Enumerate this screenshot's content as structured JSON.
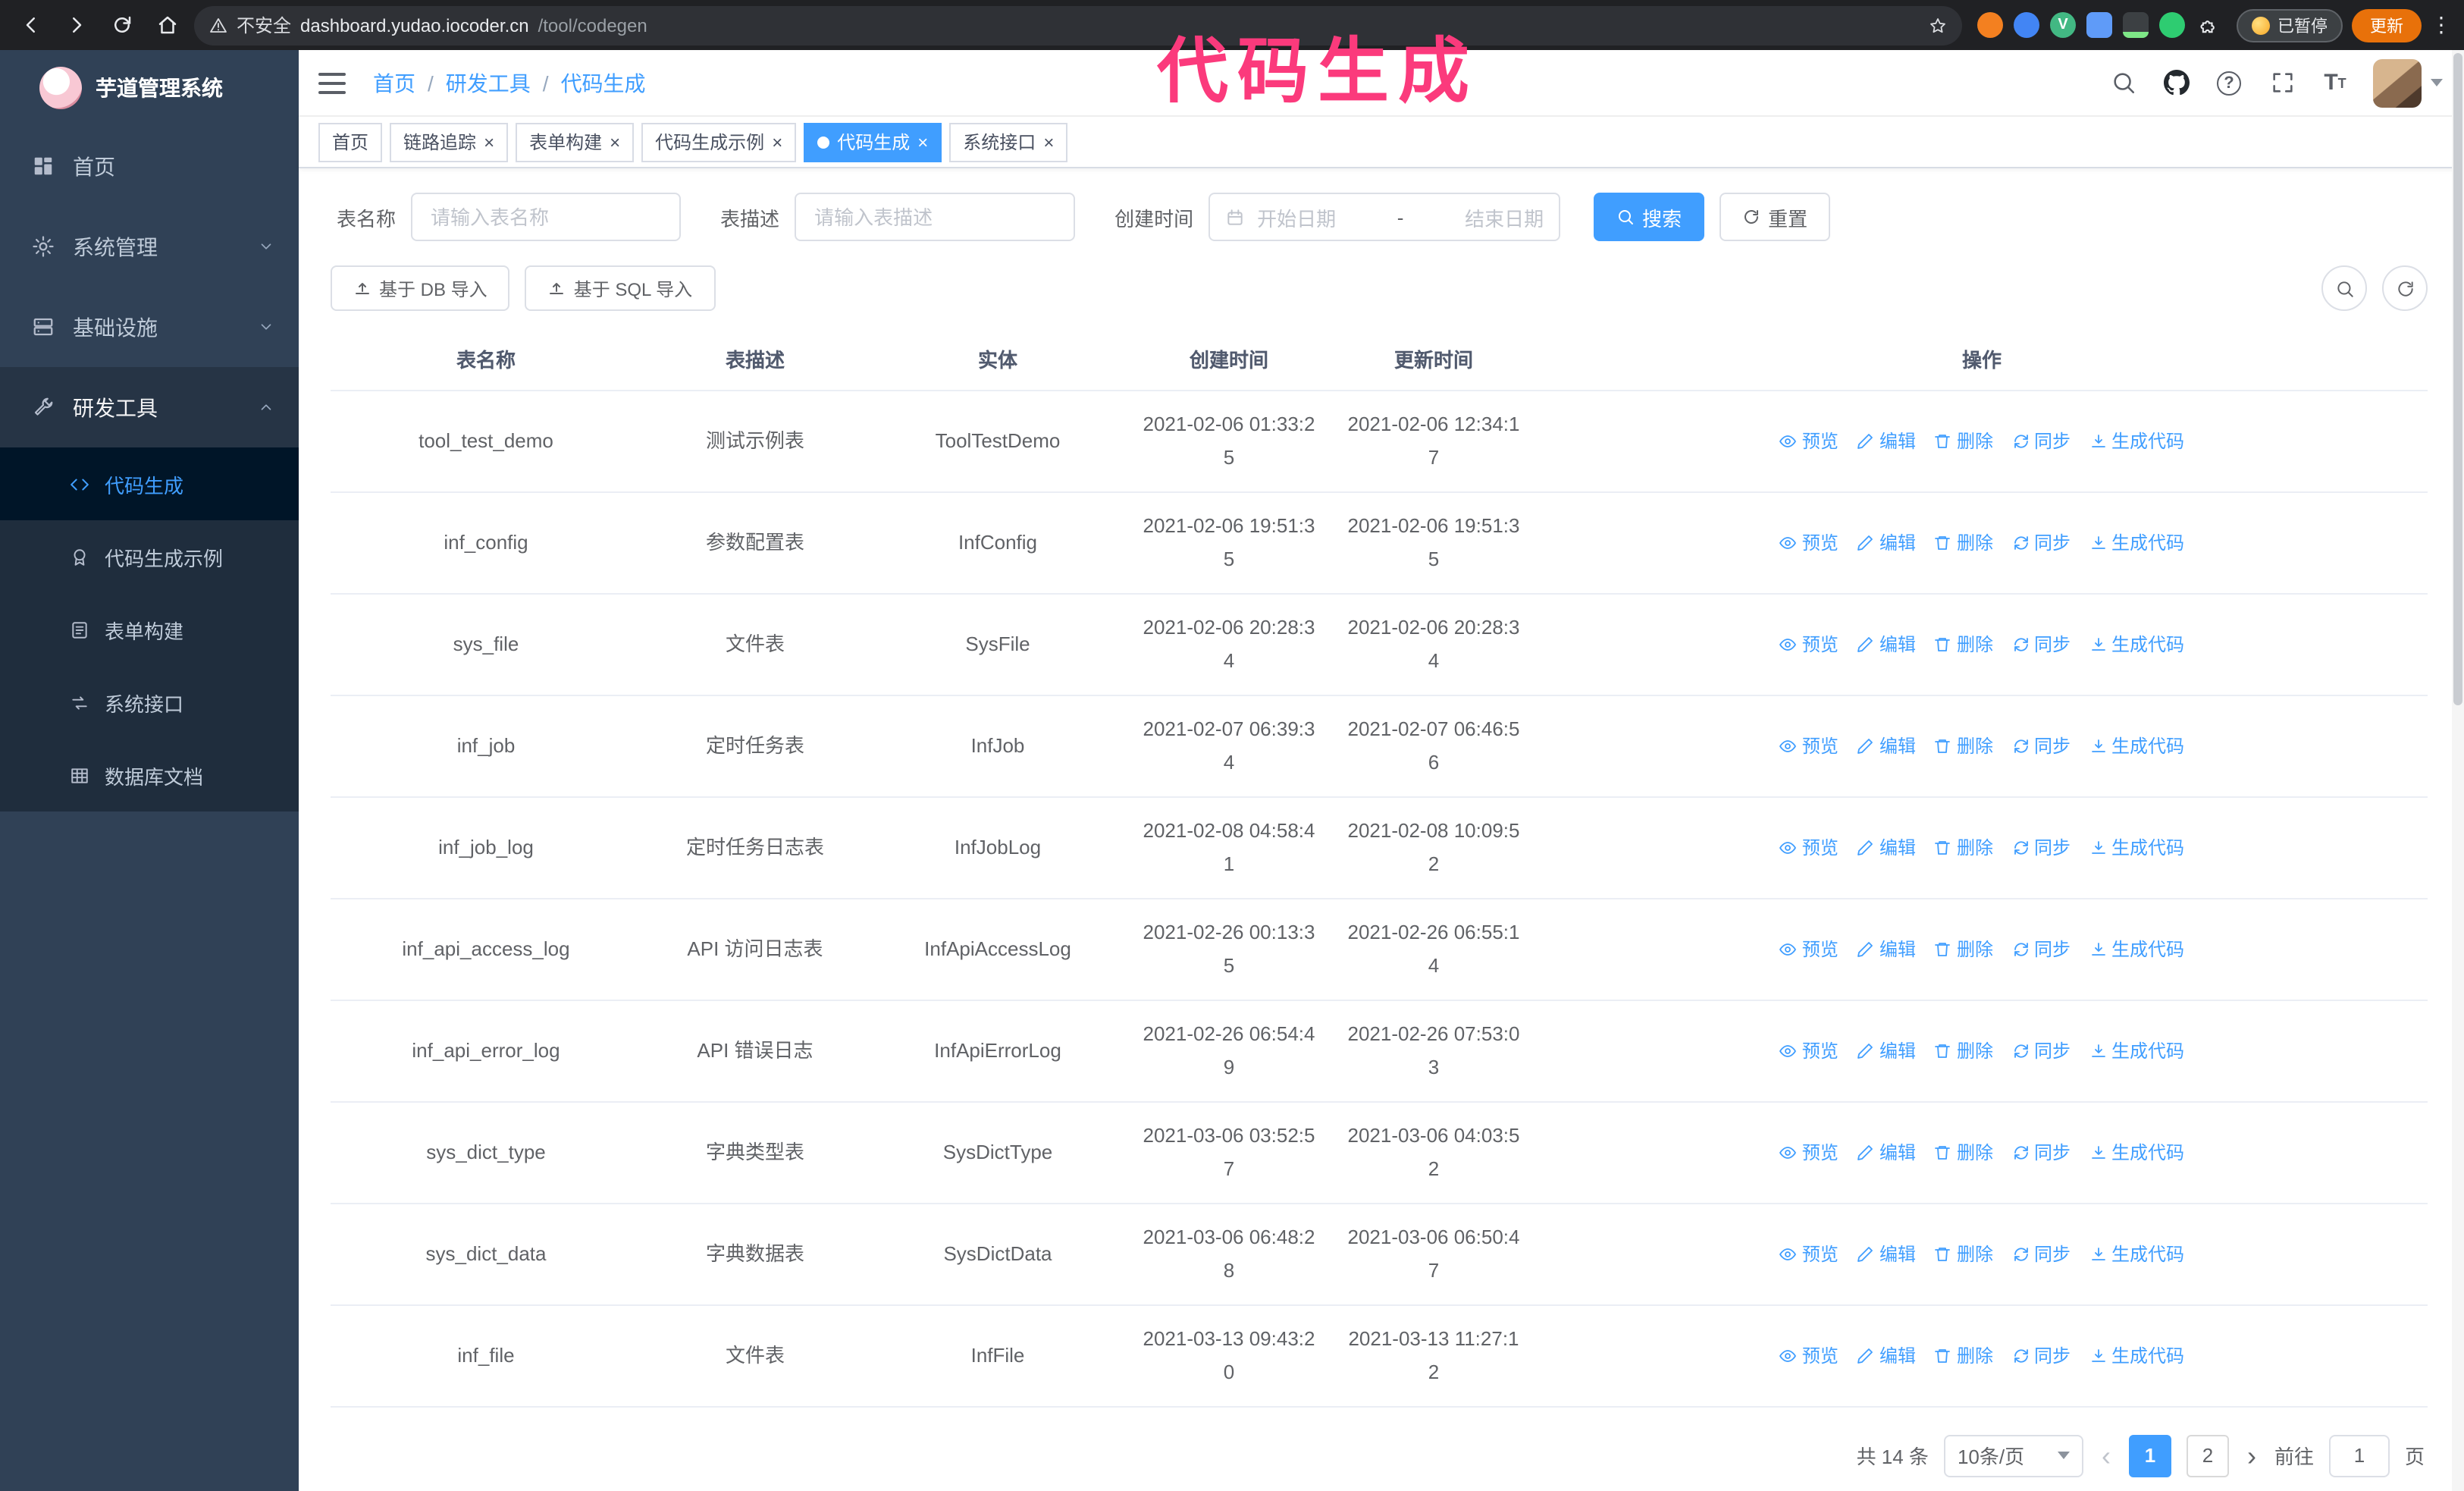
{
  "annotation": {
    "text": "代码生成"
  },
  "colors": {
    "accent": "#409eff",
    "annotation": "#fb3a7c",
    "update_button": "#e8710a",
    "sidebar_bg": "#304156"
  },
  "browser": {
    "security_label": "不安全",
    "url_host": "dashboard.yudao.iocoder.cn",
    "url_path": "/tool/codegen",
    "paused_badge": "已暂停",
    "update_button": "更新"
  },
  "sidebar": {
    "logo_title": "芋道管理系统",
    "items": [
      {
        "label": "首页"
      },
      {
        "label": "系统管理"
      },
      {
        "label": "基础设施"
      },
      {
        "label": "研发工具"
      }
    ],
    "submenu": [
      {
        "label": "代码生成"
      },
      {
        "label": "代码生成示例"
      },
      {
        "label": "表单构建"
      },
      {
        "label": "系统接口"
      },
      {
        "label": "数据库文档"
      }
    ]
  },
  "header": {
    "breadcrumb": [
      "首页",
      "研发工具",
      "代码生成"
    ]
  },
  "tabs": [
    {
      "label": "首页",
      "closable": false,
      "active": false
    },
    {
      "label": "链路追踪",
      "closable": true,
      "active": false
    },
    {
      "label": "表单构建",
      "closable": true,
      "active": false
    },
    {
      "label": "代码生成示例",
      "closable": true,
      "active": false
    },
    {
      "label": "代码生成",
      "closable": true,
      "active": true
    },
    {
      "label": "系统接口",
      "closable": true,
      "active": false
    }
  ],
  "filters": {
    "table_name_label": "表名称",
    "table_name_placeholder": "请输入表名称",
    "table_desc_label": "表描述",
    "table_desc_placeholder": "请输入表描述",
    "create_time_label": "创建时间",
    "date_start_placeholder": "开始日期",
    "date_separator": "-",
    "date_end_placeholder": "结束日期",
    "search_button": "搜索",
    "reset_button": "重置"
  },
  "toolbar": {
    "import_db": "基于 DB 导入",
    "import_sql": "基于 SQL 导入"
  },
  "table": {
    "columns": [
      "表名称",
      "表描述",
      "实体",
      "创建时间",
      "更新时间",
      "操作"
    ],
    "actions": [
      "预览",
      "编辑",
      "删除",
      "同步",
      "生成代码"
    ],
    "action_keys": [
      "preview",
      "edit",
      "delete",
      "sync",
      "generate"
    ],
    "action_icons": [
      "eye-icon",
      "pencil-icon",
      "trash-icon",
      "sync-icon",
      "download-icon"
    ],
    "rows": [
      {
        "name": "tool_test_demo",
        "desc": "测试示例表",
        "entity": "ToolTestDemo",
        "created": "2021-02-06 01:33:25",
        "updated": "2021-02-06 12:34:17"
      },
      {
        "name": "inf_config",
        "desc": "参数配置表",
        "entity": "InfConfig",
        "created": "2021-02-06 19:51:35",
        "updated": "2021-02-06 19:51:35"
      },
      {
        "name": "sys_file",
        "desc": "文件表",
        "entity": "SysFile",
        "created": "2021-02-06 20:28:34",
        "updated": "2021-02-06 20:28:34"
      },
      {
        "name": "inf_job",
        "desc": "定时任务表",
        "entity": "InfJob",
        "created": "2021-02-07 06:39:34",
        "updated": "2021-02-07 06:46:56"
      },
      {
        "name": "inf_job_log",
        "desc": "定时任务日志表",
        "entity": "InfJobLog",
        "created": "2021-02-08 04:58:41",
        "updated": "2021-02-08 10:09:52"
      },
      {
        "name": "inf_api_access_log",
        "desc": "API 访问日志表",
        "entity": "InfApiAccessLog",
        "created": "2021-02-26 00:13:35",
        "updated": "2021-02-26 06:55:14"
      },
      {
        "name": "inf_api_error_log",
        "desc": "API 错误日志",
        "entity": "InfApiErrorLog",
        "created": "2021-02-26 06:54:49",
        "updated": "2021-02-26 07:53:03"
      },
      {
        "name": "sys_dict_type",
        "desc": "字典类型表",
        "entity": "SysDictType",
        "created": "2021-03-06 03:52:57",
        "updated": "2021-03-06 04:03:52"
      },
      {
        "name": "sys_dict_data",
        "desc": "字典数据表",
        "entity": "SysDictData",
        "created": "2021-03-06 06:48:28",
        "updated": "2021-03-06 06:50:47"
      },
      {
        "name": "inf_file",
        "desc": "文件表",
        "entity": "InfFile",
        "created": "2021-03-13 09:43:20",
        "updated": "2021-03-13 11:27:12"
      }
    ]
  },
  "pagination": {
    "total": "共 14 条",
    "page_size": "10条/页",
    "pages": [
      "1",
      "2"
    ],
    "current": "1",
    "goto_label": "前往",
    "goto_value": "1",
    "page_unit": "页"
  }
}
